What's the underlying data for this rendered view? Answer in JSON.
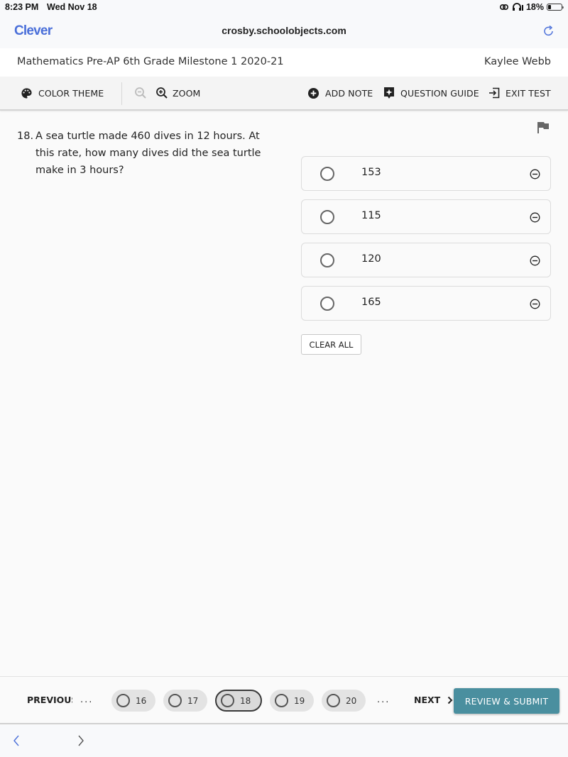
{
  "status_bar": {
    "time": "8:23 PM",
    "date": "Wed Nov 18",
    "battery_percent": "18%",
    "icons": [
      "link-icon",
      "headphones-icon",
      "battery-icon"
    ]
  },
  "browser": {
    "brand": "Clever",
    "url": "crosby.schoolobjects.com",
    "reload_icon": "reload-icon"
  },
  "header": {
    "exam_title": "Mathematics Pre-AP 6th Grade Milestone 1 2020-21",
    "student_name": "Kaylee Webb"
  },
  "toolbar": {
    "color_theme": "COLOR THEME",
    "zoom": "ZOOM",
    "add_note": "ADD NOTE",
    "question_guide": "QUESTION GUIDE",
    "exit_test": "EXIT TEST"
  },
  "question": {
    "number": "18.",
    "text": "A sea turtle made 460 dives in 12 hours. At this rate, how many dives did the sea turtle make in 3 hours?",
    "choices": [
      {
        "label": "153",
        "selected": false
      },
      {
        "label": "115",
        "selected": false
      },
      {
        "label": "120",
        "selected": false
      },
      {
        "label": "165",
        "selected": false
      }
    ],
    "clear_all": "CLEAR ALL"
  },
  "navigation": {
    "previous": "PREVIOUS",
    "ellipsis": "...",
    "questions": [
      {
        "num": "16",
        "current": false
      },
      {
        "num": "17",
        "current": false
      },
      {
        "num": "18",
        "current": true
      },
      {
        "num": "19",
        "current": false
      },
      {
        "num": "20",
        "current": false
      }
    ],
    "next": "NEXT",
    "review_submit": "REVIEW & SUBMIT",
    "accent_color": "#4a8f9f"
  }
}
